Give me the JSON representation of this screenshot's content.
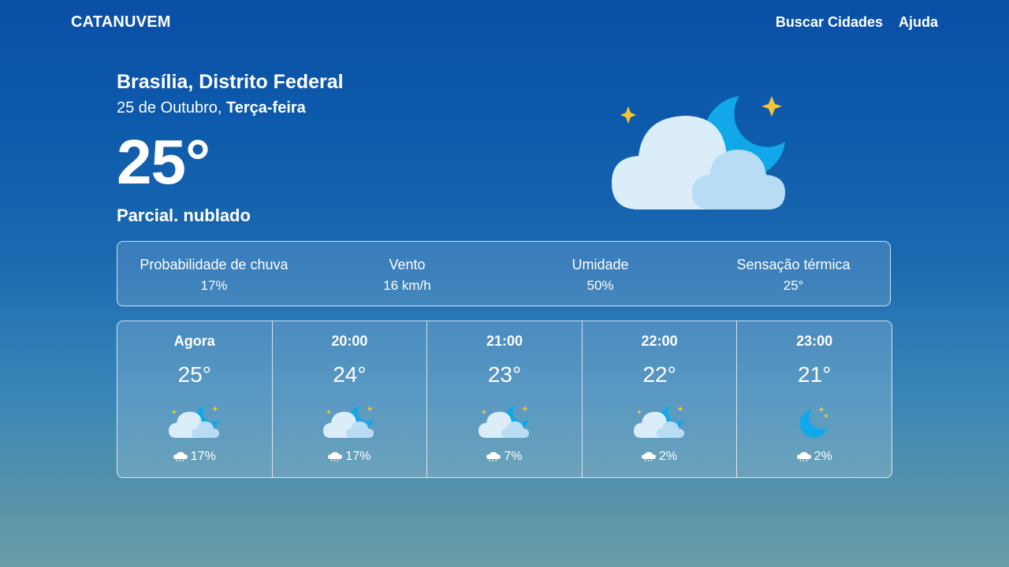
{
  "header": {
    "brand": "CATANUVEM",
    "nav": [
      "Buscar Cidades",
      "Ajuda"
    ]
  },
  "current": {
    "location": "Brasília, Distrito Federal",
    "date_day": "25 de Outubro, ",
    "date_weekday": "Terça-feira",
    "temperature": "25°",
    "condition": "Parcial. nublado",
    "icon": "partly-cloudy-night-icon"
  },
  "stats": [
    {
      "label": "Probabilidade de chuva",
      "value": "17%"
    },
    {
      "label": "Vento",
      "value": "16 km/h"
    },
    {
      "label": "Umidade",
      "value": "50%"
    },
    {
      "label": "Sensação térmica",
      "value": "25°"
    }
  ],
  "hourly": [
    {
      "time": "Agora",
      "temp": "25°",
      "icon": "partly-cloudy-night-icon",
      "rain": "17%"
    },
    {
      "time": "20:00",
      "temp": "24°",
      "icon": "partly-cloudy-night-icon",
      "rain": "17%"
    },
    {
      "time": "21:00",
      "temp": "23°",
      "icon": "partly-cloudy-night-icon",
      "rain": "7%"
    },
    {
      "time": "22:00",
      "temp": "22°",
      "icon": "partly-cloudy-night-icon",
      "rain": "2%"
    },
    {
      "time": "23:00",
      "temp": "21°",
      "icon": "clear-night-moon-icon",
      "rain": "2%"
    }
  ],
  "colors": {
    "background_top": "#0a4fa6",
    "background_bottom": "#6a9ca8",
    "moon": "#10a8e8",
    "star": "#f7c531",
    "cloud_front": "#b8dcf4",
    "cloud_back": "#dcedfa"
  }
}
